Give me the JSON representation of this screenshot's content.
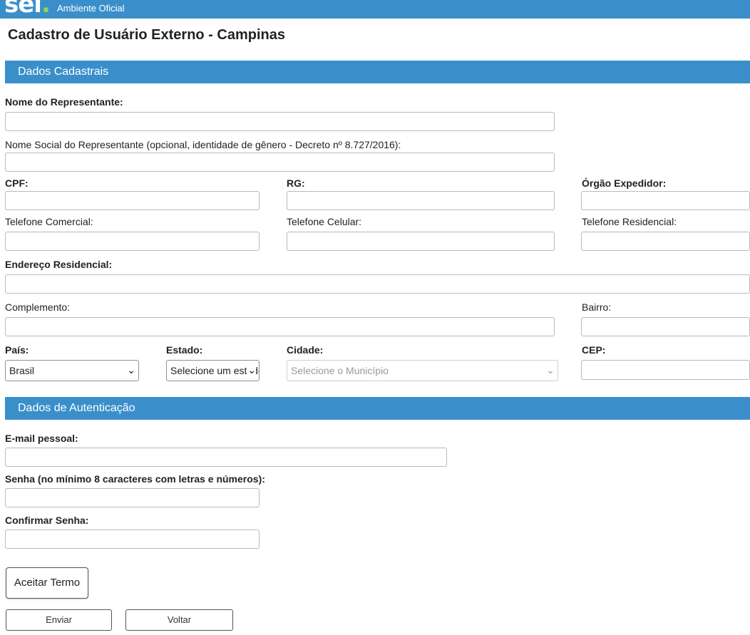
{
  "header": {
    "logo": "sei",
    "logo_dot": ".",
    "environment": "Ambiente Oficial"
  },
  "page": {
    "title": "Cadastro de Usuário Externo - Campinas"
  },
  "sections": {
    "cadastrais": "Dados Cadastrais",
    "autenticacao": "Dados de Autenticação"
  },
  "fields": {
    "nome_representante": "Nome do Representante:",
    "nome_social": "Nome Social do Representante (opcional, identidade de gênero - Decreto nº 8.727/2016):",
    "cpf": "CPF:",
    "rg": "RG:",
    "orgao_expedidor": "Órgão Expedidor:",
    "telefone_comercial": "Telefone Comercial:",
    "telefone_celular": "Telefone Celular:",
    "telefone_residencial": "Telefone Residencial:",
    "endereco_residencial": "Endereço Residencial:",
    "complemento": "Complemento:",
    "bairro": "Bairro:",
    "pais": "País:",
    "estado": "Estado:",
    "cidade": "Cidade:",
    "cep": "CEP:",
    "email": "E-mail pessoal:",
    "senha": "Senha (no mínimo 8 caracteres com letras e números):",
    "confirmar_senha": "Confirmar Senha:"
  },
  "selects": {
    "pais_value": "Brasil",
    "estado_value": "Selecione um estado",
    "cidade_value": "Selecione o Município"
  },
  "buttons": {
    "aceitar_termo": "Aceitar Termo",
    "enviar": "Enviar",
    "voltar": "Voltar"
  }
}
